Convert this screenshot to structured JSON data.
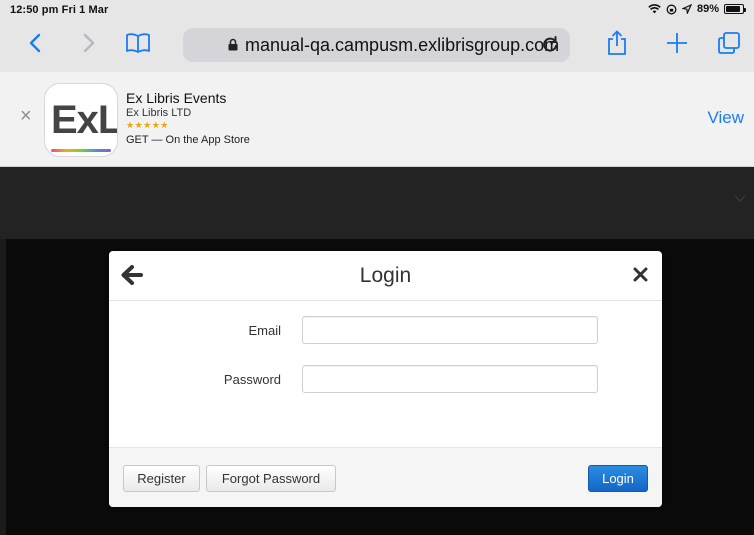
{
  "status": {
    "time_date": "12:50 pm  Fri 1 Mar",
    "battery": "89%",
    "battery_level": 0.89
  },
  "browser": {
    "url": "manual-qa.campusm.exlibrisgroup.com",
    "icons": [
      "back-chevron",
      "forward-chevron",
      "bookmarks-book",
      "lock",
      "reload",
      "share",
      "plus",
      "tabs"
    ]
  },
  "app_banner": {
    "icon_text": "ExL",
    "title": "Ex Libris Events",
    "vendor": "Ex Libris LTD",
    "stars": "★★★★★",
    "get_text": "GET — On the App Store",
    "view_label": "View"
  },
  "modal": {
    "title": "Login",
    "email_label": "Email",
    "email_value": "",
    "password_label": "Password",
    "password_value": "",
    "register_label": "Register",
    "forgot_label": "Forgot Password",
    "login_label": "Login"
  },
  "colors": {
    "accent": "#1a7cf4",
    "primary_button": "#1466c8",
    "page_background": "#1c1c1c"
  }
}
